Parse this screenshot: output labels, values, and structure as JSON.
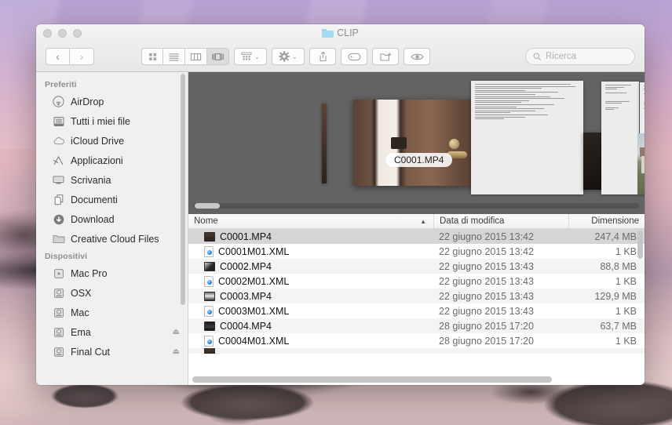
{
  "window": {
    "title": "CLIP",
    "title_icon": "folder-icon",
    "traffic_lights": [
      "close",
      "minimize",
      "zoom"
    ]
  },
  "toolbar": {
    "back_label": "‹",
    "forward_label": "›",
    "view_buttons": [
      {
        "name": "icon-view",
        "selected": false
      },
      {
        "name": "list-view",
        "selected": false
      },
      {
        "name": "column-view",
        "selected": false
      },
      {
        "name": "coverflow-view",
        "selected": true
      }
    ],
    "arrange_icon": "arrange-icon",
    "action_icon": "gear-icon",
    "share_icon": "share-icon",
    "tag_icon": "tag-icon",
    "newfolder_icon": "new-folder-icon",
    "quicklook_icon": "eye-icon",
    "caret": "⌄"
  },
  "search": {
    "placeholder": "Ricerca",
    "value": "",
    "icon": "search-icon"
  },
  "sidebar": {
    "sections": [
      {
        "heading": "Preferiti",
        "items": [
          {
            "label": "AirDrop",
            "icon": "airdrop-icon",
            "eject": false
          },
          {
            "label": "Tutti i miei file",
            "icon": "all-my-files-icon",
            "eject": false
          },
          {
            "label": "iCloud Drive",
            "icon": "icloud-icon",
            "eject": false
          },
          {
            "label": "Applicazioni",
            "icon": "applications-icon",
            "eject": false
          },
          {
            "label": "Scrivania",
            "icon": "desktop-icon",
            "eject": false
          },
          {
            "label": "Documenti",
            "icon": "documents-icon",
            "eject": false
          },
          {
            "label": "Download",
            "icon": "downloads-icon",
            "eject": false
          },
          {
            "label": "Creative Cloud Files",
            "icon": "folder-icon",
            "eject": false
          }
        ]
      },
      {
        "heading": "Dispositivi",
        "items": [
          {
            "label": "Mac Pro",
            "icon": "computer-icon",
            "eject": false
          },
          {
            "label": "OSX",
            "icon": "harddisk-icon",
            "eject": false
          },
          {
            "label": "Mac",
            "icon": "harddisk-icon",
            "eject": false
          },
          {
            "label": "Ema",
            "icon": "harddisk-icon",
            "eject": true
          },
          {
            "label": "Final Cut",
            "icon": "harddisk-icon",
            "eject": true
          }
        ]
      }
    ],
    "eject_glyph": "⏏"
  },
  "coverflow": {
    "center_label": "C0001.MP4",
    "scroll_position": "left"
  },
  "filelist": {
    "columns": [
      {
        "key": "name",
        "label": "Nome",
        "sorted": true,
        "sort_arrow": "▲"
      },
      {
        "key": "date",
        "label": "Data di modifica",
        "sorted": false
      },
      {
        "key": "size",
        "label": "Dimensione",
        "sorted": false
      }
    ],
    "rows": [
      {
        "name": "C0001.MP4",
        "date": "22 giugno 2015 13:42",
        "size": "247,4 MB",
        "icon": "video-thumbnail-icon",
        "selected": true
      },
      {
        "name": "C0001M01.XML",
        "date": "22 giugno 2015 13:42",
        "size": "1 KB",
        "icon": "xml-document-icon",
        "selected": false
      },
      {
        "name": "C0002.MP4",
        "date": "22 giugno 2015 13:43",
        "size": "88,8 MB",
        "icon": "video-thumbnail-icon",
        "selected": false
      },
      {
        "name": "C0002M01.XML",
        "date": "22 giugno 2015 13:43",
        "size": "1 KB",
        "icon": "xml-document-icon",
        "selected": false
      },
      {
        "name": "C0003.MP4",
        "date": "22 giugno 2015 13:43",
        "size": "129,9 MB",
        "icon": "video-thumbnail-icon",
        "selected": false
      },
      {
        "name": "C0003M01.XML",
        "date": "22 giugno 2015 13:43",
        "size": "1 KB",
        "icon": "xml-document-icon",
        "selected": false
      },
      {
        "name": "C0004.MP4",
        "date": "28 giugno 2015 17:20",
        "size": "63,7 MB",
        "icon": "video-thumbnail-icon",
        "selected": false
      },
      {
        "name": "C0004M01.XML",
        "date": "28 giugno 2015 17:20",
        "size": "1 KB",
        "icon": "xml-document-icon",
        "selected": false
      }
    ]
  },
  "colors": {
    "selection": "#d5d5d5",
    "coverflow_bg": "#636363",
    "sidebar_bg": "#f0f0f0",
    "folder_blue": "#a6d9f2"
  }
}
